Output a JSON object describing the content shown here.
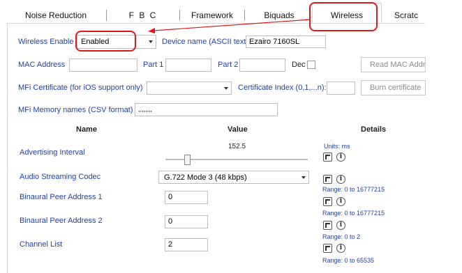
{
  "tabs": [
    {
      "label": "Noise Reduction"
    },
    {
      "label": "F B C"
    },
    {
      "label": "Framework"
    },
    {
      "label": "Biquads"
    },
    {
      "label": "Wireless"
    },
    {
      "label": "Scratc"
    }
  ],
  "wireless_enable": {
    "label": "Wireless Enable",
    "value": "Enabled"
  },
  "device_name": {
    "label": "Device name (ASCII text)",
    "value": "Ezairo 7160SL"
  },
  "mac": {
    "label": "MAC Address",
    "part1_label": "Part 1",
    "part2_label": "Part 2",
    "dec_label": "Dec",
    "read_button": "Read MAC Addr"
  },
  "mfi": {
    "label": "MFi Certificate (for iOS support only)",
    "index_label": "Certificate Index (0,1,...n):",
    "burn_button": "Burn certificate"
  },
  "mfi_memory": {
    "label": "MFi Memory names (CSV format)",
    "value": ",,,,,,,,"
  },
  "table": {
    "headers": {
      "name": "Name",
      "value": "Value",
      "details": "Details"
    },
    "rows": [
      {
        "name": "Advertising Interval",
        "value": "152.5",
        "details": "Units:  ms"
      },
      {
        "name": "Audio Streaming Codec",
        "value": "G.722 Mode 3  (48 kbps)",
        "details": "Range:  0  to  16777215"
      },
      {
        "name": "Binaural Peer Address 1",
        "value": "0",
        "details": "Range:  0  to  16777215"
      },
      {
        "name": "Binaural Peer Address 2",
        "value": "0",
        "details": "Range:  0  to  2"
      },
      {
        "name": "Channel List",
        "value": "2",
        "details": "Range:  0  to  65535"
      }
    ]
  },
  "slider": {
    "fraction": 0.14
  },
  "colors": {
    "accent": "#1f3fae",
    "highlight": "#e01818"
  }
}
